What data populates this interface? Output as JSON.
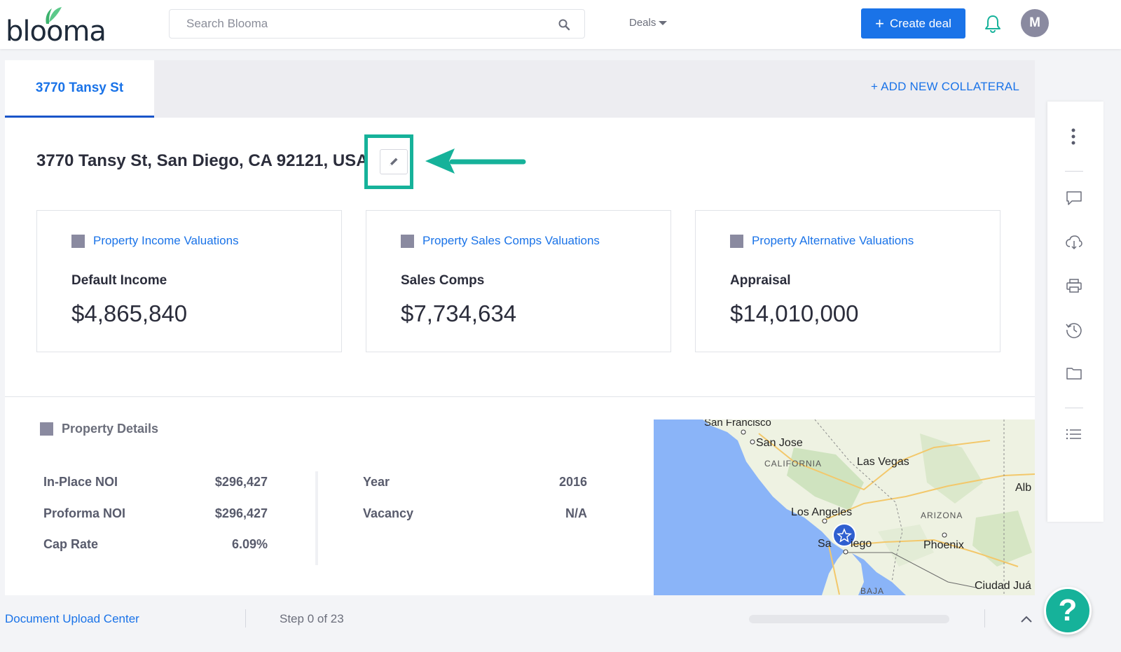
{
  "header": {
    "logo_text": "blooma",
    "search_placeholder": "Search Blooma",
    "deals_label": "Deals",
    "create_deal_label": "Create deal",
    "avatar_initial": "M"
  },
  "tabs": {
    "active_label": "3770 Tansy St",
    "add_collateral_label": "+ ADD NEW COLLATERAL"
  },
  "property": {
    "address": "3770 Tansy St, San Diego, CA 92121, USA"
  },
  "valuations": [
    {
      "title": "Property Income Valuations",
      "label": "Default Income",
      "amount": "$4,865,840"
    },
    {
      "title": "Property Sales Comps Valuations",
      "label": "Sales Comps",
      "amount": "$7,734,634"
    },
    {
      "title": "Property Alternative Valuations",
      "label": "Appraisal",
      "amount": "$14,010,000"
    }
  ],
  "details": {
    "title": "Property Details",
    "left": [
      {
        "label": "In-Place NOI",
        "value": "$296,427"
      },
      {
        "label": "Proforma NOI",
        "value": "$296,427"
      },
      {
        "label": "Cap Rate",
        "value": "6.09%"
      }
    ],
    "right": [
      {
        "label": "Year",
        "value": "2016"
      },
      {
        "label": "Vacancy",
        "value": "N/A"
      }
    ]
  },
  "map_labels": {
    "san_francisco": "San Francisco",
    "san_jose": "San Jose",
    "california": "CALIFORNIA",
    "las_vegas": "Las Vegas",
    "alb": "Alb",
    "los_angeles": "Los Angeles",
    "arizona": "ARIZONA",
    "san_diego_left": "Sa",
    "san_diego_right": "iego",
    "phoenix": "Phoenix",
    "ciudad": "Ciudad Juá",
    "baja": "BAJA"
  },
  "footer": {
    "doc_center_label": "Document Upload Center",
    "step_label": "Step 0 of 23",
    "help_label": "?"
  },
  "colors": {
    "accent": "#1a73e8",
    "highlight": "#16b29a",
    "square": "#8a8aa0"
  }
}
